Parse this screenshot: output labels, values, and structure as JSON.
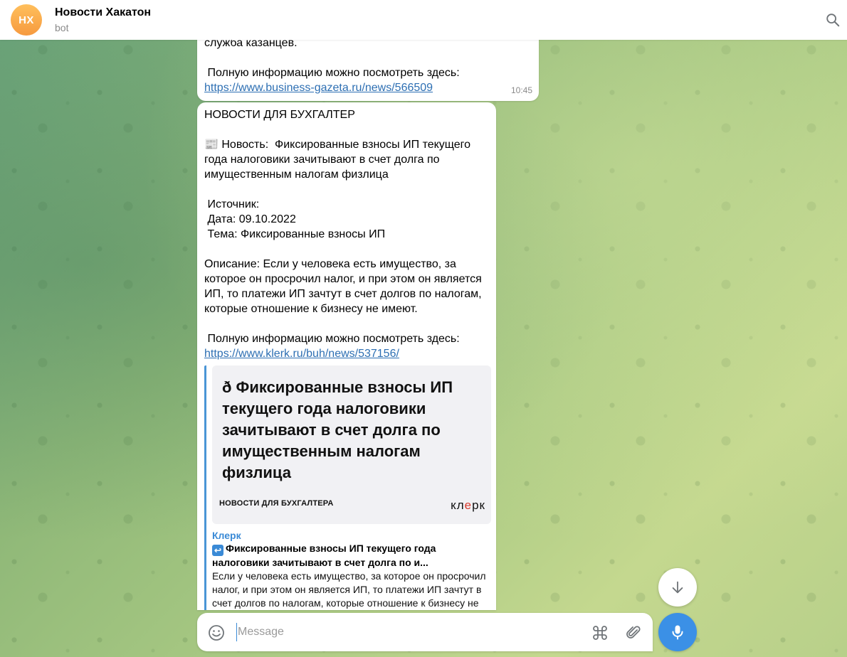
{
  "header": {
    "avatar_initials": "НХ",
    "title": "Новости Хакатон",
    "status": "bot"
  },
  "messages": [
    {
      "lines": [
        "служба казанцев.",
        "",
        " Полную информацию можно посмотреть здесь:"
      ],
      "link": "https://www.business-gazeta.ru/news/566509",
      "time": "10:45"
    },
    {
      "heading": "НОВОСТИ ДЛЯ БУХГАЛТЕР",
      "news_line1": "📰 Новость:  Фиксированные взносы ИП текущего",
      "news_line2": "года налоговики зачитывают в счет долга по",
      "news_line3": "имущественным налогам физлица",
      "source": " Источник:",
      "date": " Дата: 09.10.2022",
      "topic": " Тема: Фиксированные взносы ИП",
      "description": "Описание: Если у человека есть имущество, за\nкоторое он просрочил налог, и при этом он является\nИП, то платежи ИП зачтут в счет долгов по налогам,\nкоторые отношение к бизнесу не имеют.",
      "more_info": " Полную информацию можно посмотреть здесь:",
      "link": "https://www.klerk.ru/buh/news/537156/",
      "preview": {
        "image_heading": "ð    Фиксированные взносы ИП текущего года налоговики зачитывают в счет долга по имущественным налогам физлица",
        "image_footer": "НОВОСТИ ДЛЯ БУХГАЛТЕРА",
        "logo_left": "кл",
        "logo_accent": "e",
        "logo_right": "рк",
        "site_name": "Клерк",
        "title": "Фиксированные взносы ИП текущего года налоговики зачитывают в счет долга по и...",
        "description": "Если у человека есть имущество, за которое он просрочил налог, и при этом он является ИП, то платежи ИП зачтут в счет долгов по налогам, которые отношение к бизнесу не имеют."
      }
    }
  ],
  "composer": {
    "placeholder": "Message"
  },
  "icons": {
    "search": "search-icon",
    "emoji": "smile-icon",
    "command": "command-icon",
    "attach": "paperclip-icon",
    "mic": "microphone-icon",
    "scroll": "arrow-down-icon"
  },
  "colors": {
    "accent": "#3b90e6",
    "link": "#2d6fb3",
    "avatar": "#f69a3f"
  }
}
